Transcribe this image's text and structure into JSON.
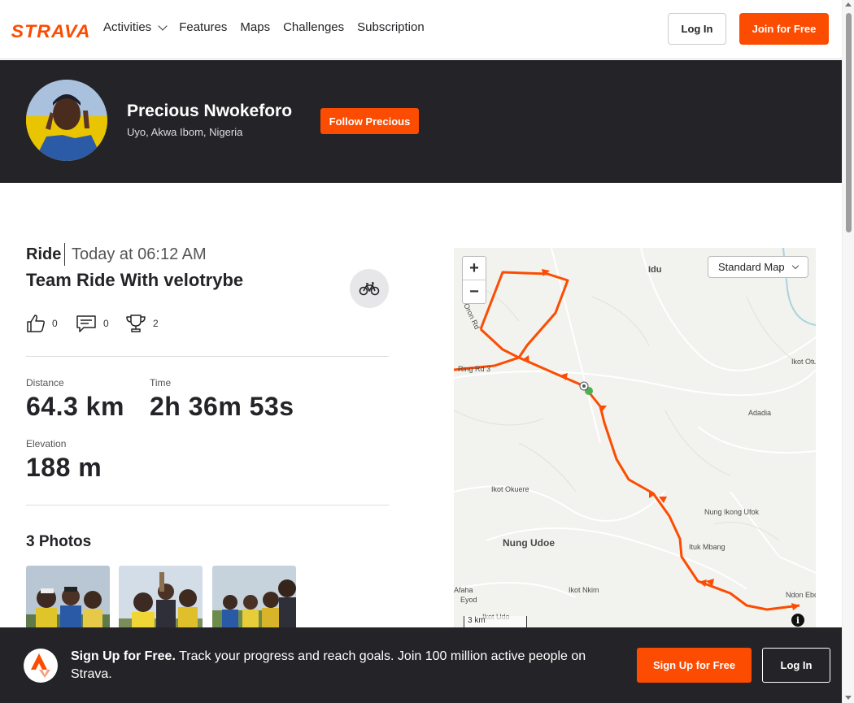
{
  "nav": {
    "logo": "STRAVA",
    "links": [
      "Activities",
      "Features",
      "Maps",
      "Challenges",
      "Subscription"
    ],
    "login_label": "Log In",
    "join_label": "Join for Free",
    "brand_color": "#fc4c02"
  },
  "athlete": {
    "name": "Precious Nwokeforo",
    "location": "Uyo, Akwa Ibom, Nigeria",
    "follow_label": "Follow Precious"
  },
  "activity": {
    "type": "Ride",
    "date": "Today at 06:12 AM",
    "title": "Team Ride With velotrybe",
    "sport_icon": "bike-icon",
    "kudos": "0",
    "comments": "0",
    "achievements": "2",
    "stats": {
      "distance_label": "Distance",
      "distance_value": "64.3 km",
      "time_label": "Time",
      "time_value": "2h 36m 53s",
      "elevation_label": "Elevation",
      "elevation_value": "188 m"
    },
    "photos_title": "3 Photos"
  },
  "map": {
    "map_type": "Standard Map",
    "scale_label": "3 km",
    "places": [
      "Idu",
      "Ikot Otu",
      "Adadia",
      "Ikot Okuere",
      "Nung Ikong Ufok",
      "Ituk Mbang",
      "Nung Udoe",
      "Ikot Nkim",
      "Ndon Ebo",
      "Afaha",
      "Eyod",
      "Ikot Udo",
      "Ring Rd 3",
      "Oron Rd"
    ],
    "zoom_in": "+",
    "zoom_out": "−",
    "info": "i"
  },
  "banner": {
    "bold": "Sign Up for Free.",
    "text": " Track your progress and reach goals. Join 100 million active people on Strava.",
    "signup_label": "Sign Up for Free",
    "login_label": "Log In"
  }
}
